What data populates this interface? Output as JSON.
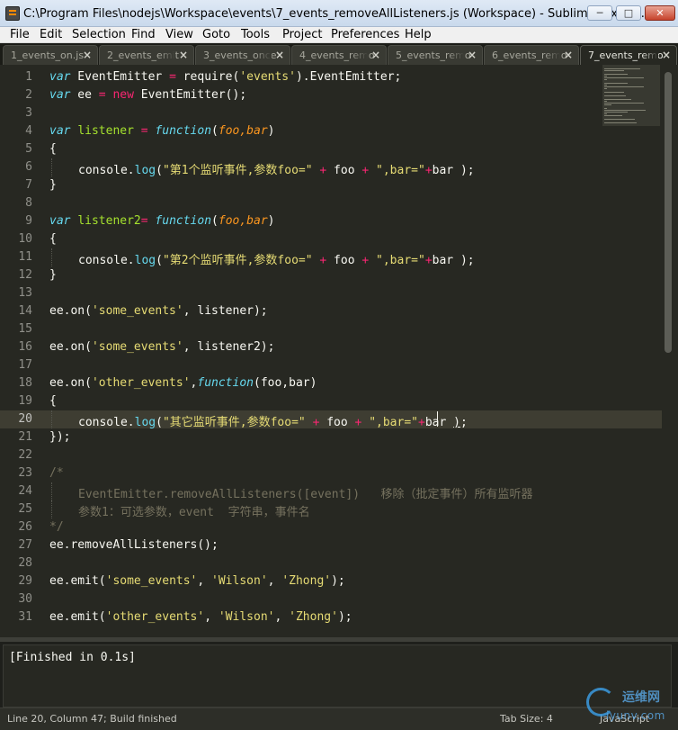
{
  "window": {
    "title": "C:\\Program Files\\nodejs\\Workspace\\events\\7_events_removeAllListeners.js (Workspace) - Sublime Text 2 ...",
    "minimize_glyph": "─",
    "maximize_glyph": "□",
    "close_glyph": "✕"
  },
  "menu": [
    "File",
    "Edit",
    "Selection",
    "Find",
    "View",
    "Goto",
    "Tools",
    "Project",
    "Preferences",
    "Help"
  ],
  "tabs": [
    {
      "label": "1_events_on.js",
      "close": "×",
      "active": false
    },
    {
      "label": "2_events_emit",
      "close": "×",
      "active": false
    },
    {
      "label": "3_events_once",
      "close": "×",
      "active": false
    },
    {
      "label": "4_events_remo",
      "close": "×",
      "active": false
    },
    {
      "label": "5_events_remo",
      "close": "×",
      "active": false
    },
    {
      "label": "6_events_remo",
      "close": "×",
      "active": false
    },
    {
      "label": "7_events_remo",
      "close": "×",
      "active": true
    }
  ],
  "editor": {
    "current_line": 20,
    "line_numbers": [
      "1",
      "2",
      "3",
      "4",
      "5",
      "6",
      "7",
      "8",
      "9",
      "10",
      "11",
      "12",
      "13",
      "14",
      "15",
      "16",
      "17",
      "18",
      "19",
      "20",
      "21",
      "22",
      "23",
      "24",
      "25",
      "26",
      "27",
      "28",
      "29",
      "30",
      "31"
    ],
    "tokens": {
      "l1": [
        "var",
        " EventEmitter ",
        "=",
        " require(",
        "'events'",
        ").EventEmitter;"
      ],
      "l2": [
        "var",
        " ee ",
        "=",
        " ",
        "new",
        " EventEmitter();"
      ],
      "l4": [
        "var",
        " ",
        "listener",
        " ",
        "=",
        " ",
        "function",
        "(",
        "foo,bar",
        ")"
      ],
      "l5": [
        "{"
      ],
      "l6": [
        "console.",
        "log",
        "(",
        "\"第1个监听事件,参数foo=\"",
        " ",
        "+",
        " foo ",
        "+",
        " ",
        "\",bar=\"",
        "+",
        "bar );"
      ],
      "l7": [
        "}"
      ],
      "l9": [
        "var",
        " ",
        "listener2",
        "=",
        " ",
        "function",
        "(",
        "foo,bar",
        ")"
      ],
      "l10": [
        "{"
      ],
      "l11": [
        "console.",
        "log",
        "(",
        "\"第2个监听事件,参数foo=\"",
        " ",
        "+",
        " foo ",
        "+",
        " ",
        "\",bar=\"",
        "+",
        "bar );"
      ],
      "l12": [
        "}"
      ],
      "l14": [
        "ee.on(",
        "'some_events'",
        ", listener);"
      ],
      "l16": [
        "ee.on(",
        "'some_events'",
        ", listener2);"
      ],
      "l18": [
        "ee.on(",
        "'other_events'",
        ",",
        "function",
        "(foo,bar)"
      ],
      "l19": [
        "{"
      ],
      "l20": [
        "console.",
        "log",
        "(",
        "\"其它监听事件,参数foo=\"",
        " ",
        "+",
        " foo ",
        "+",
        " ",
        "\",bar=\"",
        "+",
        "bar ",
        ")",
        ";"
      ],
      "l21": [
        "});"
      ],
      "l23": [
        "/*"
      ],
      "l24": [
        "EventEmitter.removeAllListeners([event])   移除（批定事件）所有监听器"
      ],
      "l25": [
        "参数1：可选参数，event  字符串，事件名"
      ],
      "l26": [
        "*/"
      ],
      "l27": [
        "ee.removeAllListeners();"
      ],
      "l29": [
        "ee.emit(",
        "'some_events'",
        ", ",
        "'Wilson'",
        ", ",
        "'Zhong'",
        ");"
      ],
      "l31": [
        "ee.emit(",
        "'other_events'",
        ", ",
        "'Wilson'",
        ", ",
        "'Zhong'",
        ");"
      ]
    }
  },
  "build_output": "[Finished in 0.1s]",
  "status": {
    "position": "Line 20, Column 47; Build finished",
    "tab_size": "Tab Size: 4",
    "syntax": "JavaScript"
  },
  "watermark": {
    "line1": "运维网",
    "line2": "iyunv.com"
  },
  "colors": {
    "background": "#272822",
    "keyword": "#66d9ef",
    "string": "#e6db74",
    "operator": "#f92672",
    "function_name": "#a6e22e",
    "parameter": "#fd971f",
    "comment": "#75715e"
  }
}
